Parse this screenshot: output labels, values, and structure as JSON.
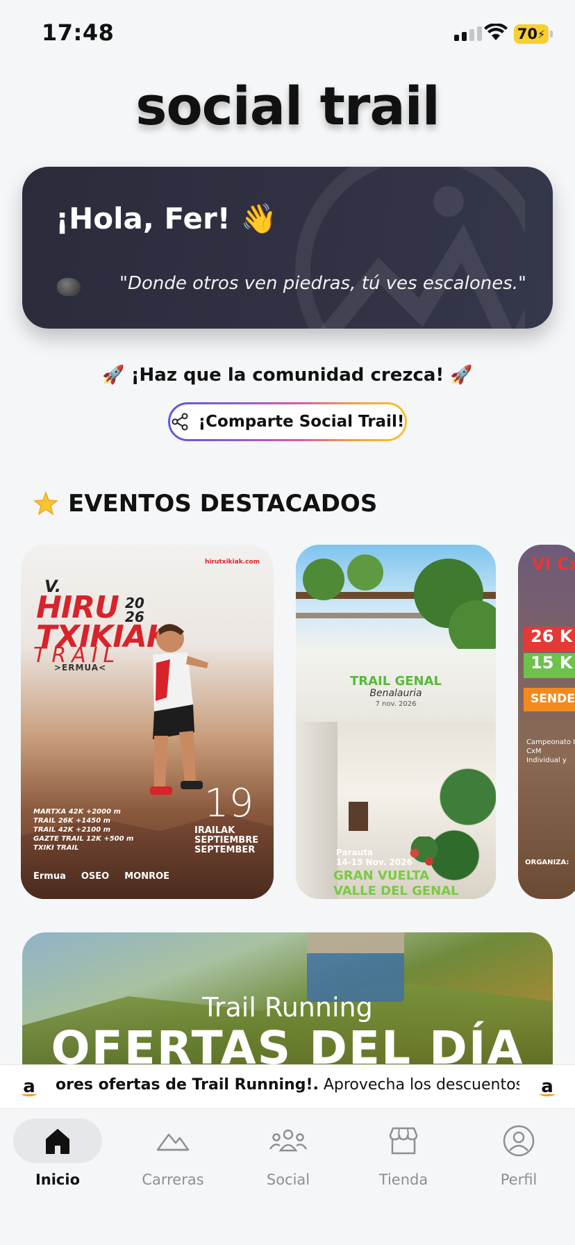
{
  "status_bar": {
    "time": "17:48",
    "battery": "70"
  },
  "app_title": "social trail",
  "greeting": {
    "title": "¡Hola, Fer! 👋",
    "quote": "\"Donde otros ven piedras, tú ves escalones.\""
  },
  "community": {
    "text": "🚀 ¡Haz que la comunidad crezca! 🚀",
    "share_label": "¡Comparte Social Trail!"
  },
  "events": {
    "title": "EVENTOS DESTACADOS",
    "items": [
      {
        "v": "V.",
        "name": "HIRU\nTXIKIAK",
        "year": "20\n26",
        "trail": "TRAIL",
        "location": ">ERMUA<",
        "website": "hirutxikiak.com",
        "distances": "MARTXA 42K +2000 m\nTRAIL 26K +1450 m\nTRAIL 42K +2100 m\nGAZTE TRAIL 12K +500 m\nTXIKI TRAIL",
        "day": "19",
        "month": "IRAILAK\nSEPTIEMBRE\nSEPTEMBER",
        "sponsors": [
          "Ermua",
          "OSEO",
          "MONROE"
        ]
      },
      {
        "title": "TRAIL GENAL",
        "subtitle": "Benalauria",
        "date": "7 nov. 2026",
        "title2_place": "Parauta\n14-15 Nov. 2026",
        "title2": "GRAN VUELTA\nVALLE DEL GENAL"
      },
      {
        "title": "VI Cx",
        "badges": [
          "26 K",
          "15 K",
          "SENDERI"
        ],
        "small": "Campeonato I\nCxM\nIndividual y",
        "org": "ORGANIZA:"
      }
    ]
  },
  "offers": {
    "line1": "Trail Running",
    "line2": "OFERTAS DEL DÍA"
  },
  "ticker": {
    "bold": "ores ofertas de Trail Running!.",
    "text": " Aprovecha los descuentos en m"
  },
  "tabs": [
    {
      "label": "Inicio",
      "icon": "home-icon",
      "active": true
    },
    {
      "label": "Carreras",
      "icon": "mountain-icon",
      "active": false
    },
    {
      "label": "Social",
      "icon": "group-icon",
      "active": false
    },
    {
      "label": "Tienda",
      "icon": "store-icon",
      "active": false
    },
    {
      "label": "Perfil",
      "icon": "profile-icon",
      "active": false
    }
  ],
  "colors": {
    "accent_red": "#d8232a",
    "card_dark": "#2a2b3b",
    "battery": "#f7cf2e"
  }
}
